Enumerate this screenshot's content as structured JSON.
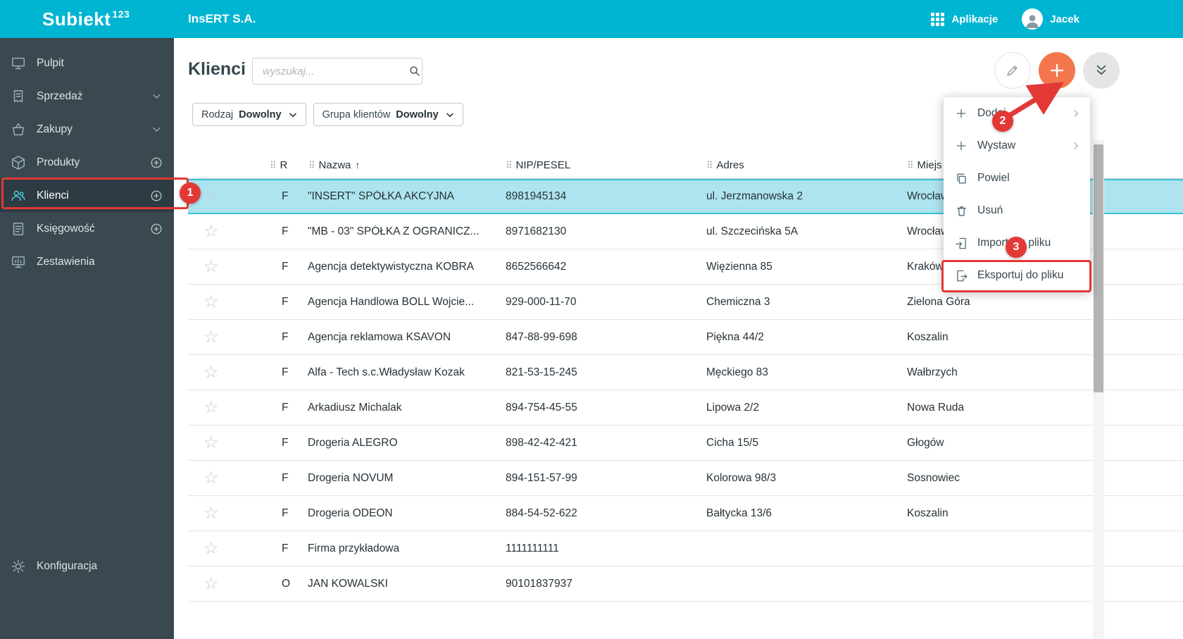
{
  "colors": {
    "teal": "#00b5d1",
    "sidebar": "#3a484f",
    "sidebar-active": "#2d3b42",
    "orange": "#f4764d",
    "sel": "#aee4ef",
    "sel-border": "#36c3da",
    "red": "#e23836"
  },
  "icons": {
    "star": "☆",
    "drag_handle": "⠿",
    "sort_asc": "↑"
  },
  "topbar": {
    "brand": "Subiekt",
    "brand_sup": "123",
    "company": "InsERT S.A.",
    "apps_label": "Aplikacje",
    "user_name": "Jacek"
  },
  "sidebar": {
    "items": [
      {
        "label": "Pulpit"
      },
      {
        "label": "Sprzedaż"
      },
      {
        "label": "Zakupy"
      },
      {
        "label": "Produkty"
      },
      {
        "label": "Klienci",
        "active": true
      },
      {
        "label": "Księgowość"
      },
      {
        "label": "Zestawienia"
      }
    ],
    "bottom": {
      "label": "Konfiguracja"
    }
  },
  "page": {
    "title": "Klienci",
    "search_placeholder": "wyszukaj..."
  },
  "filters": [
    {
      "label": "Rodzaj",
      "value": "Dowolny"
    },
    {
      "label": "Grupa klientów",
      "value": "Dowolny"
    }
  ],
  "menu": {
    "items": [
      {
        "label": "Dodaj"
      },
      {
        "label": "Wystaw"
      },
      {
        "label": "Powiel"
      },
      {
        "label": "Usuń"
      },
      {
        "label": "Importuj z pliku"
      },
      {
        "label": "Eksportuj do pliku"
      }
    ]
  },
  "table": {
    "columns": [
      "R",
      "Nazwa",
      "NIP/PESEL",
      "Adres",
      "Miejs"
    ],
    "sort_indicator": "↑",
    "rows": [
      {
        "type": "F",
        "name": "\"INSERT\" SPÓŁKA AKCYJNA",
        "nip": "8981945134",
        "address": "ul. Jerzmanowska 2",
        "city": "Wrocław",
        "selected": true
      },
      {
        "type": "F",
        "name": "\"MB - 03\" SPÓŁKA Z OGRANICZ...",
        "nip": "8971682130",
        "address": "ul. Szczecińska 5A",
        "city": "Wrocław"
      },
      {
        "type": "F",
        "name": "Agencja detektywistyczna KOBRA",
        "nip": "8652566642",
        "address": "Więzienna 85",
        "city": "Kraków"
      },
      {
        "type": "F",
        "name": "Agencja Handlowa BOLL Wojcie...",
        "nip": "929-000-11-70",
        "address": "Chemiczna 3",
        "city": "Zielona Góra"
      },
      {
        "type": "F",
        "name": "Agencja reklamowa KSAVON",
        "nip": "847-88-99-698",
        "address": "Piękna 44/2",
        "city": "Koszalin"
      },
      {
        "type": "F",
        "name": "Alfa - Tech s.c.Władysław Kozak",
        "nip": "821-53-15-245",
        "address": "Męckiego 83",
        "city": "Wałbrzych"
      },
      {
        "type": "F",
        "name": "Arkadiusz Michalak",
        "nip": "894-754-45-55",
        "address": "Lipowa 2/2",
        "city": "Nowa Ruda"
      },
      {
        "type": "F",
        "name": "Drogeria ALEGRO",
        "nip": "898-42-42-421",
        "address": "Cicha 15/5",
        "city": "Głogów"
      },
      {
        "type": "F",
        "name": "Drogeria NOVUM",
        "nip": "894-151-57-99",
        "address": "Kolorowa 98/3",
        "city": "Sosnowiec"
      },
      {
        "type": "F",
        "name": "Drogeria ODEON",
        "nip": "884-54-52-622",
        "address": "Bałtycka 13/6",
        "city": "Koszalin"
      },
      {
        "type": "F",
        "name": "Firma przykładowa",
        "nip": "1111111111",
        "address": "",
        "city": ""
      },
      {
        "type": "O",
        "name": "JAN KOWALSKI",
        "nip": "90101837937",
        "address": "",
        "city": ""
      }
    ]
  },
  "annotations": {
    "step1": "1",
    "step2": "2",
    "step3": "3"
  }
}
